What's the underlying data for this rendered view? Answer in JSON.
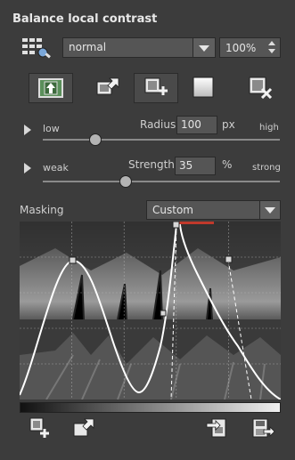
{
  "panel": {
    "title": "Balance local contrast",
    "blend_mode": "normal",
    "opacity": "100%"
  },
  "toolbar": [
    {
      "name": "apply-mask-button",
      "icon": "mask-apply-icon"
    },
    {
      "name": "load-mask-button",
      "icon": "mask-load-icon"
    },
    {
      "name": "add-mask-button",
      "icon": "mask-add-icon"
    },
    {
      "name": "blank-mask-button",
      "icon": "blank-square-icon"
    },
    {
      "name": "delete-mask-button",
      "icon": "mask-delete-icon"
    }
  ],
  "radius": {
    "low_label": "low",
    "label": "Radius",
    "value": "100",
    "unit": "px",
    "high_label": "high",
    "slider_fraction": 0.28
  },
  "strength": {
    "low_label": "weak",
    "label": "Strength",
    "value": "35",
    "unit": "%",
    "high_label": "strong",
    "slider_fraction": 0.35
  },
  "masking": {
    "label": "Masking",
    "mode": "Custom"
  },
  "colors": {
    "panel": "#3c3c3c",
    "curve": "#ffffff",
    "accent_red": "#c0392b"
  }
}
